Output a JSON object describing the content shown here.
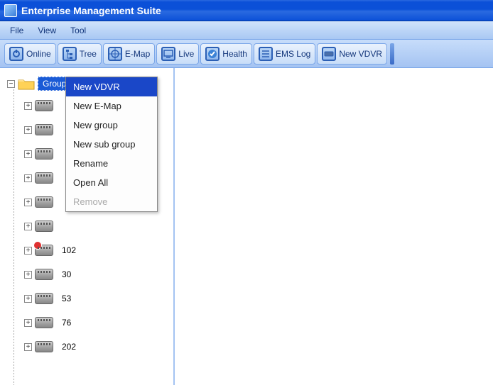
{
  "title": "Enterprise Management Suite",
  "menu": {
    "items": [
      "File",
      "View",
      "Tool"
    ]
  },
  "toolbar": {
    "buttons": [
      {
        "label": "Online",
        "icon": "power-icon"
      },
      {
        "label": "Tree",
        "icon": "tree-icon"
      },
      {
        "label": "E-Map",
        "icon": "target-icon"
      },
      {
        "label": "Live",
        "icon": "monitor-icon"
      },
      {
        "label": "Health",
        "icon": "check-icon"
      },
      {
        "label": "EMS Log",
        "icon": "log-icon"
      },
      {
        "label": "New VDVR",
        "icon": "dvr-icon"
      }
    ]
  },
  "tree": {
    "root": {
      "label": "Group",
      "expanded": true,
      "selected": true
    },
    "children": [
      {
        "label": "",
        "alert": false
      },
      {
        "label": "",
        "alert": false
      },
      {
        "label": "",
        "alert": false
      },
      {
        "label": "",
        "alert": false
      },
      {
        "label": "",
        "alert": false
      },
      {
        "label": "",
        "alert": false
      },
      {
        "label": "102",
        "alert": true
      },
      {
        "label": "30",
        "alert": false
      },
      {
        "label": "53",
        "alert": false
      },
      {
        "label": "76",
        "alert": false
      },
      {
        "label": "202",
        "alert": false
      }
    ]
  },
  "context_menu": {
    "items": [
      {
        "label": "New VDVR",
        "highlight": true,
        "disabled": false
      },
      {
        "label": "New E-Map",
        "highlight": false,
        "disabled": false
      },
      {
        "label": "New group",
        "highlight": false,
        "disabled": false
      },
      {
        "label": "New sub group",
        "highlight": false,
        "disabled": false
      },
      {
        "label": "Rename",
        "highlight": false,
        "disabled": false
      },
      {
        "label": "Open All",
        "highlight": false,
        "disabled": false
      },
      {
        "label": "Remove",
        "highlight": false,
        "disabled": true
      }
    ]
  }
}
